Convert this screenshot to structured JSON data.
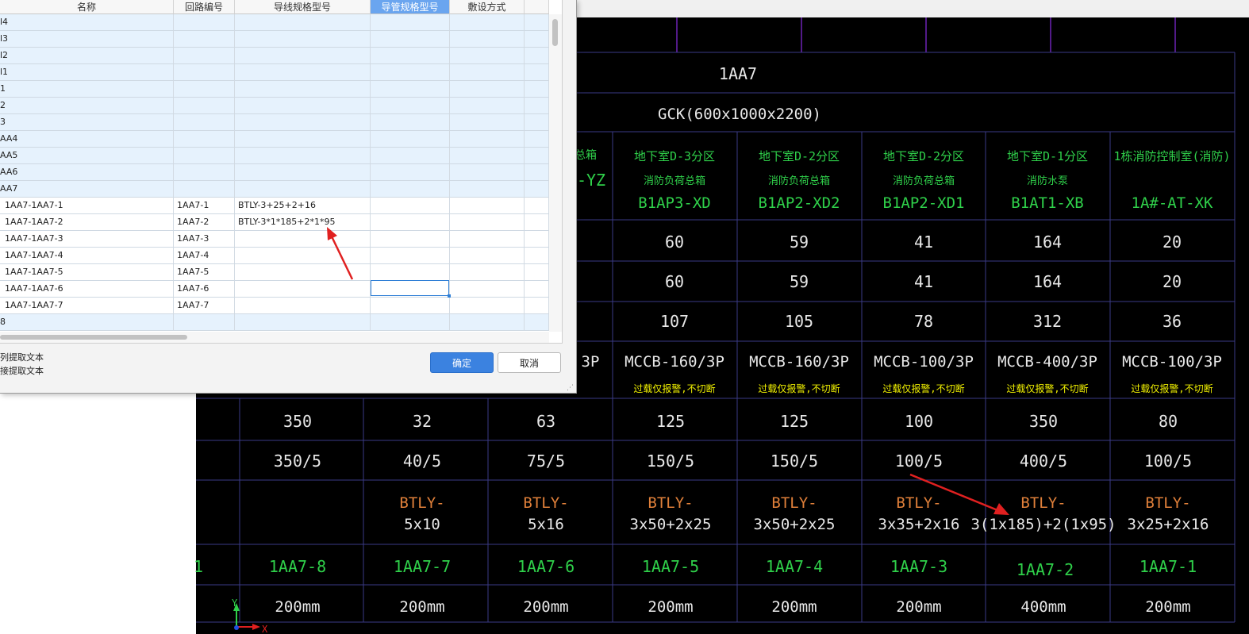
{
  "dialog": {
    "columns": [
      "名称",
      "回路编号",
      "导线规格型号",
      "导管规格型号",
      "敷设方式",
      ""
    ],
    "selected_column": 3,
    "rows": [
      {
        "type": "group",
        "cells": [
          "l4",
          "",
          "",
          "",
          "",
          ""
        ]
      },
      {
        "type": "group",
        "cells": [
          "l3",
          "",
          "",
          "",
          "",
          ""
        ]
      },
      {
        "type": "group",
        "cells": [
          "l2",
          "",
          "",
          "",
          "",
          ""
        ]
      },
      {
        "type": "group",
        "cells": [
          "l1",
          "",
          "",
          "",
          "",
          ""
        ]
      },
      {
        "type": "group",
        "cells": [
          "1",
          "",
          "",
          "",
          "",
          ""
        ]
      },
      {
        "type": "group",
        "cells": [
          "2",
          "",
          "",
          "",
          "",
          ""
        ]
      },
      {
        "type": "group",
        "cells": [
          "3",
          "",
          "",
          "",
          "",
          ""
        ]
      },
      {
        "type": "group",
        "cells": [
          "AA4",
          "",
          "",
          "",
          "",
          ""
        ]
      },
      {
        "type": "group",
        "cells": [
          "AA5",
          "",
          "",
          "",
          "",
          ""
        ]
      },
      {
        "type": "group",
        "cells": [
          "AA6",
          "",
          "",
          "",
          "",
          ""
        ]
      },
      {
        "type": "group",
        "cells": [
          "AA7",
          "",
          "",
          "",
          "",
          ""
        ]
      },
      {
        "type": "item",
        "cells": [
          "1AA7-1AA7-1",
          "1AA7-1",
          "BTLY-3+25+2+16",
          "",
          "",
          ""
        ]
      },
      {
        "type": "item",
        "cells": [
          "1AA7-1AA7-2",
          "1AA7-2",
          "BTLY-3*1*185+2*1*95",
          "",
          "",
          ""
        ]
      },
      {
        "type": "item",
        "cells": [
          "1AA7-1AA7-3",
          "1AA7-3",
          "",
          "",
          "",
          ""
        ]
      },
      {
        "type": "item",
        "cells": [
          "1AA7-1AA7-4",
          "1AA7-4",
          "",
          "",
          "",
          ""
        ]
      },
      {
        "type": "item",
        "cells": [
          "1AA7-1AA7-5",
          "1AA7-5",
          "",
          "",
          "",
          ""
        ]
      },
      {
        "type": "item",
        "cells": [
          "1AA7-1AA7-6",
          "1AA7-6",
          "",
          "",
          "",
          ""
        ]
      },
      {
        "type": "item",
        "cells": [
          "1AA7-1AA7-7",
          "1AA7-7",
          "",
          "",
          "",
          ""
        ]
      },
      {
        "type": "group",
        "cells": [
          "8",
          "",
          "",
          "",
          "",
          ""
        ]
      }
    ],
    "option1": "列提取文本",
    "option2": "接提取文本",
    "ok_label": "确定",
    "cancel_label": "取消"
  },
  "cad": {
    "cabinet_name": "1AA7",
    "cabinet_spec": "GCK(600x1000x2200)",
    "partial_name_left": "-YZ",
    "partial_title_left": "总箱",
    "partial_breaker_left": "3P",
    "columns": [
      {
        "title": "地下室D-3分区",
        "sub": "消防负荷总箱",
        "code": "B1AP3-XD",
        "v1": "60",
        "v2": "60",
        "v3": "107",
        "breaker": "MCCB-160/3P",
        "note": "过载仅报警,不切断"
      },
      {
        "title": "地下室D-2分区",
        "sub": "消防负荷总箱",
        "code": "B1AP2-XD2",
        "v1": "59",
        "v2": "59",
        "v3": "105",
        "breaker": "MCCB-160/3P",
        "note": "过载仅报警,不切断"
      },
      {
        "title": "地下室D-2分区",
        "sub": "消防负荷总箱",
        "code": "B1AP2-XD1",
        "v1": "41",
        "v2": "41",
        "v3": "78",
        "breaker": "MCCB-100/3P",
        "note": "过载仅报警,不切断"
      },
      {
        "title": "地下室D-1分区",
        "sub": "消防水泵",
        "code": "B1AT1-XB",
        "v1": "164",
        "v2": "164",
        "v3": "312",
        "breaker": "MCCB-400/3P",
        "note": "过载仅报警,不切断"
      },
      {
        "title": "1栋消防控制室(消防)",
        "sub": "",
        "code": "1A#-AT-XK",
        "v1": "20",
        "v2": "20",
        "v3": "36",
        "breaker": "MCCB-100/3P",
        "note": "过载仅报警,不切断"
      }
    ],
    "lower_columns": [
      {
        "rating": "350",
        "ct": "350/5",
        "cable1": "",
        "cable2": "",
        "circuit": "",
        "size": "200mm"
      },
      {
        "rating": "32",
        "ct": "40/5",
        "cable1": "BTLY-",
        "cable2": "5x10",
        "circuit": "1AA7-8",
        "size": "200mm"
      },
      {
        "rating": "63",
        "ct": "75/5",
        "cable1": "BTLY-",
        "cable2": "5x16",
        "circuit": "1AA7-7",
        "size": "200mm"
      },
      {
        "rating": "125",
        "ct": "150/5",
        "cable1": "BTLY-",
        "cable2": "3x50+2x25",
        "circuit": "1AA7-6",
        "size": "200mm"
      },
      {
        "rating": "125",
        "ct": "150/5",
        "cable1": "BTLY-",
        "cable2": "3x50+2x25",
        "circuit": "1AA7-5",
        "size": "200mm"
      },
      {
        "rating": "100",
        "ct": "100/5",
        "cable1": "BTLY-",
        "cable2": "3x35+2x16",
        "circuit": "1AA7-4",
        "size": "200mm"
      },
      {
        "rating": "350",
        "ct": "400/5",
        "cable1": "BTLY-",
        "cable2": "3(1x185)+2(1x95)",
        "circuit": "1AA7-3",
        "size": "200mm"
      },
      {
        "rating": "80",
        "ct": "100/5",
        "cable1": "BTLY-",
        "cable2": "3x25+2x16",
        "circuit": "1AA7-2",
        "size": "400mm"
      },
      {
        "rating": "",
        "ct": "",
        "cable1": "",
        "cable2": "",
        "circuit": "1AA7-1",
        "size": "200mm"
      }
    ],
    "partial_circuit_left": "1",
    "axis_y": "Y",
    "axis_x": "X",
    "colors": {
      "white": "#e8e8e8",
      "green": "#2fd04a",
      "yellow": "#f2f200",
      "orange": "#e0803a",
      "grid": "#3a3a86",
      "purple": "#8a2be2",
      "arrow": "#e02020"
    }
  }
}
